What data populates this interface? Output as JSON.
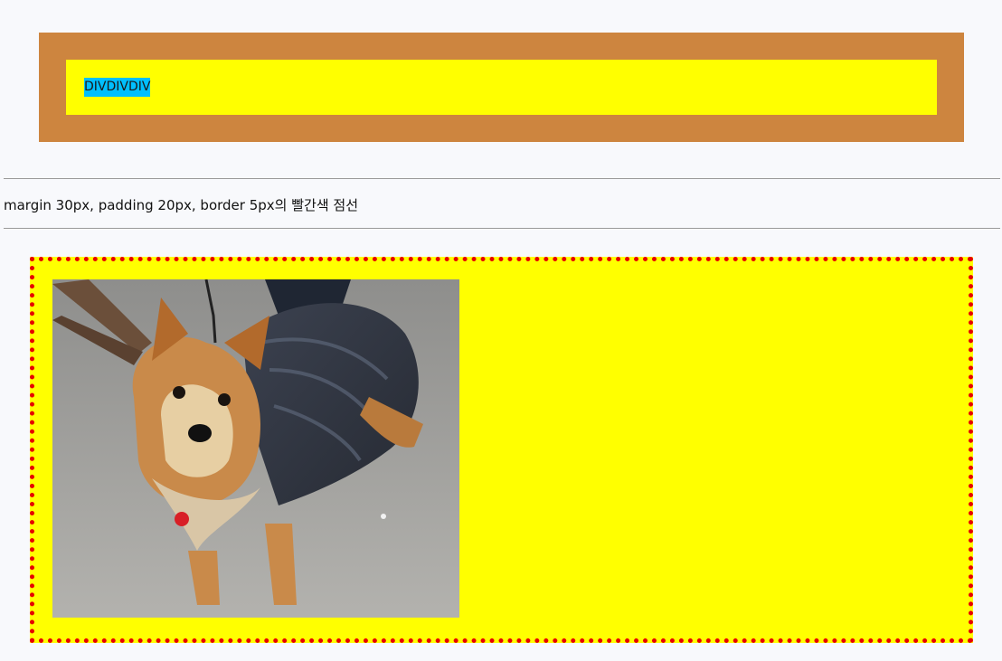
{
  "box1": {
    "text": "DIVDIVDIV"
  },
  "caption": {
    "text": "margin 30px, padding 20px, border 5px의 빨간색 점선"
  },
  "box2": {
    "image": "yorkshire-terrier-photo"
  },
  "colors": {
    "page_background": "#f8f9fc",
    "outer_box": "#cd853f",
    "inner_box": "#ffff00",
    "text_highlight": "#00bfff",
    "dotted_border": "#e60000"
  }
}
